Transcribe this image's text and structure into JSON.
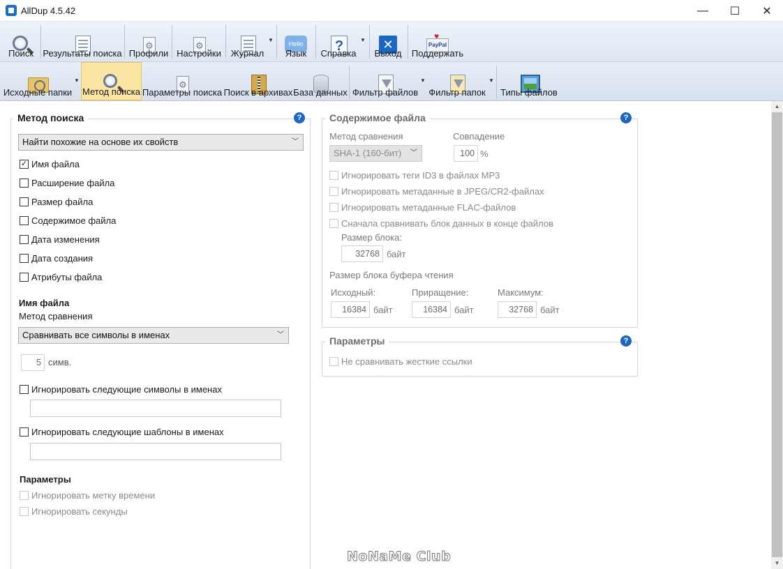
{
  "window": {
    "title": "AllDup 4.5.42"
  },
  "toolbar_main": [
    {
      "label": "Поиск",
      "icon": "search-icon"
    },
    {
      "label": "Результаты поиска",
      "icon": "search-results-icon"
    },
    {
      "label": "Профили",
      "icon": "profiles-icon"
    },
    {
      "label": "Настройки",
      "icon": "settings-icon"
    },
    {
      "label": "Журнал",
      "icon": "journal-icon"
    },
    {
      "label": "Язык",
      "icon": "language-icon",
      "icon_text": "Hello"
    },
    {
      "label": "Справка",
      "icon": "help-icon",
      "icon_text": "?"
    },
    {
      "label": "Выход",
      "icon": "exit-icon",
      "icon_text": "✕"
    },
    {
      "label": "Поддержать",
      "icon": "paypal-icon",
      "icon_text": "PayPal"
    }
  ],
  "toolbar_sub": [
    {
      "label": "Исходные папки",
      "icon": "source-folders-icon"
    },
    {
      "label": "Метод поиска",
      "icon": "search-method-icon",
      "active": true
    },
    {
      "label": "Параметры поиска",
      "icon": "search-params-icon"
    },
    {
      "label": "Поиск в архивах",
      "icon": "archive-icon"
    },
    {
      "label": "База данных",
      "icon": "database-icon"
    },
    {
      "label": "Фильтр файлов",
      "icon": "file-filter-icon"
    },
    {
      "label": "Фильтр папок",
      "icon": "folder-filter-icon"
    },
    {
      "label": "Типы файлов",
      "icon": "file-types-icon"
    }
  ],
  "search_method": {
    "title": "Метод поиска",
    "mode": "Найти похожие на основе их свойств",
    "criteria": [
      {
        "label": "Имя файла",
        "checked": true
      },
      {
        "label": "Расширение файла",
        "checked": false
      },
      {
        "label": "Размер файла",
        "checked": false
      },
      {
        "label": "Содержимое файла",
        "checked": false
      },
      {
        "label": "Дата изменения",
        "checked": false
      },
      {
        "label": "Дата создания",
        "checked": false
      },
      {
        "label": "Атрибуты файла",
        "checked": false
      }
    ],
    "filename_section": "Имя файла",
    "compare_label": "Метод сравнения",
    "compare_value": "Сравнивать все символы в именах",
    "chars_value": "5",
    "chars_unit": "симв.",
    "ignore_chars_label": "Игнорировать следующие символы в именах",
    "ignore_patterns_label": "Игнорировать следующие шаблоны в именах",
    "params_section": "Параметры",
    "ignore_timestamp": "Игнорировать метку времени",
    "ignore_seconds": "Игнорировать секунды"
  },
  "file_content": {
    "title": "Содержимое файла",
    "compare_label": "Метод сравнения",
    "compare_value": "SHA-1 (160-бит)",
    "match_label": "Совпадение",
    "match_value": "100",
    "match_unit": "%",
    "opt_id3": "Игнорировать теги ID3 в файлах MP3",
    "opt_jpeg": "Игнорировать метаданные в JPEG/CR2-файлах",
    "opt_flac": "Игнорировать метаданные FLAC-файлов",
    "opt_endblock": "Сначала сравнивать блок данных в конце файлов",
    "block_size_label": "Размер блока:",
    "block_size_value": "32768",
    "unit_bytes": "байт",
    "buffer_label": "Размер блока буфера чтения",
    "initial_label": "Исходный:",
    "initial_value": "16384",
    "increment_label": "Приращение:",
    "increment_value": "16384",
    "max_label": "Максимум:",
    "max_value": "32768"
  },
  "parameters": {
    "title": "Параметры",
    "no_hardlinks": "Не сравнивать жесткие ссылки"
  },
  "watermark": "NoNaMe Club"
}
